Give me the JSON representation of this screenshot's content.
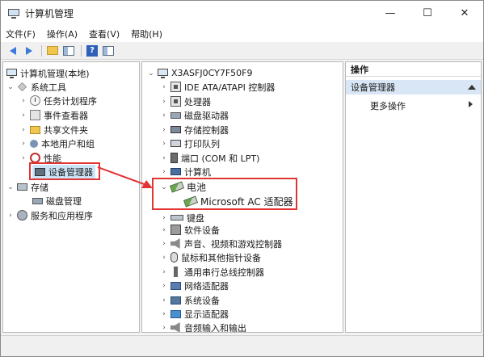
{
  "window": {
    "title": "计算机管理",
    "controls": {
      "minimize": "—",
      "maximize": "☐",
      "close": "✕"
    }
  },
  "menubar": {
    "items": [
      "文件(F)",
      "操作(A)",
      "查看(V)",
      "帮助(H)"
    ]
  },
  "left_tree": {
    "root": "计算机管理(本地)",
    "system_tools": "系统工具",
    "items": [
      "任务计划程序",
      "事件查看器",
      "共享文件夹",
      "本地用户和组",
      "性能",
      "设备管理器"
    ],
    "storage": "存储",
    "disk_management": "磁盘管理",
    "services": "服务和应用程序"
  },
  "device_tree": {
    "computer_name": "X3ASFJ0CY7F50F9",
    "categories_top": [
      "IDE ATA/ATAPI 控制器",
      "处理器",
      "磁盘驱动器",
      "存储控制器",
      "打印队列",
      "端口 (COM 和 LPT)",
      "计算机"
    ],
    "battery": "电池",
    "battery_child": "Microsoft AC 适配器",
    "categories_bottom": [
      "键盘",
      "软件设备",
      "声音、视频和游戏控制器",
      "鼠标和其他指针设备",
      "通用串行总线控制器",
      "网络适配器",
      "系统设备",
      "显示适配器",
      "音频输入和输出"
    ]
  },
  "actions": {
    "header": "操作",
    "section": "设备管理器",
    "more": "更多操作"
  },
  "colors": {
    "highlight": "#e23434",
    "selection": "#cce4f7",
    "section_bg": "#d9e6f5"
  }
}
